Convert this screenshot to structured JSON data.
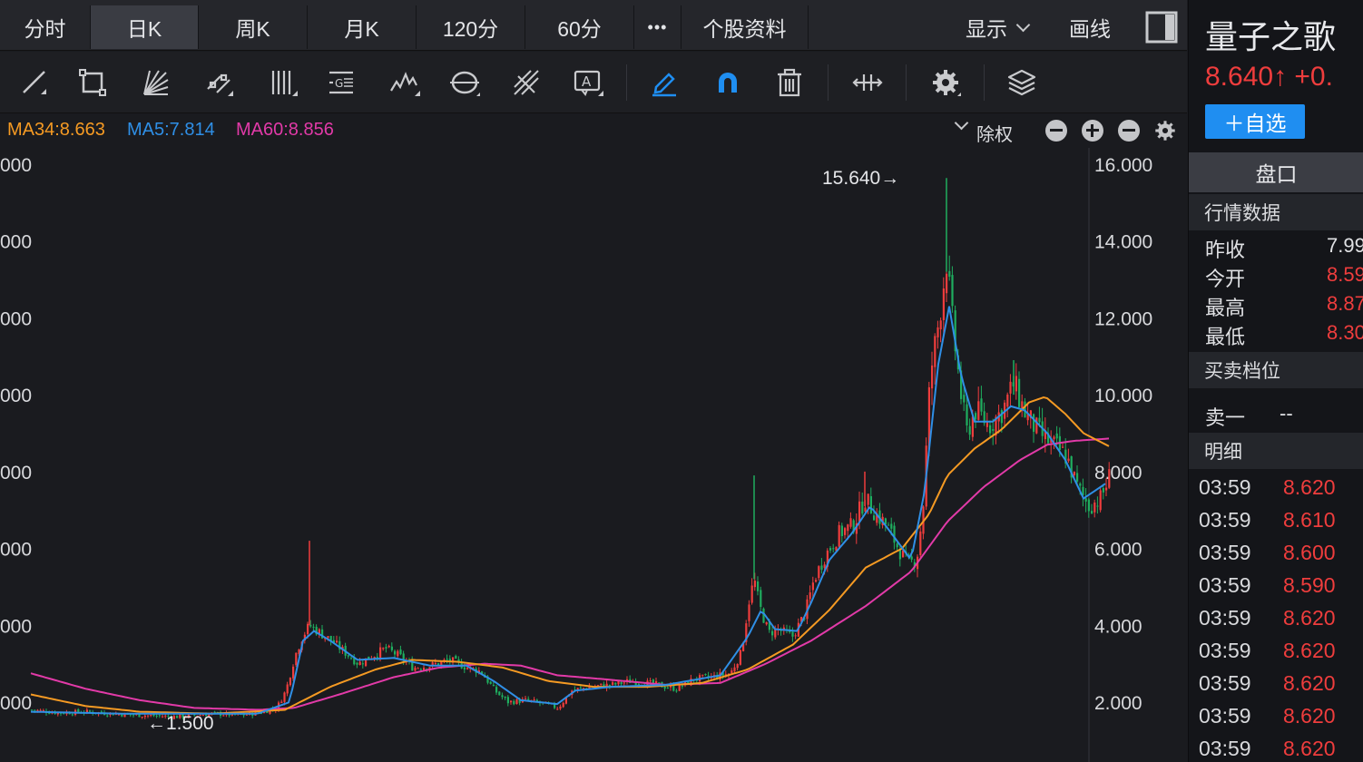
{
  "tabs": [
    {
      "label": "分时",
      "active": false
    },
    {
      "label": "日K",
      "active": true
    },
    {
      "label": "周K",
      "active": false
    },
    {
      "label": "月K",
      "active": false
    },
    {
      "label": "120分",
      "active": false
    },
    {
      "label": "60分",
      "active": false
    },
    {
      "label": "•••",
      "active": false
    },
    {
      "label": "个股资料",
      "active": false
    }
  ],
  "top_right": {
    "display_label": "显示",
    "draw_label": "画线"
  },
  "toolbar": {
    "icons": [
      "line-tool-icon",
      "rectangle-tool-icon",
      "fan-tool-icon",
      "channel-tool-icon",
      "vertical-lines-icon",
      "fibonacci-icon",
      "wave-tool-icon",
      "cycle-tool-icon",
      "pitchfork-icon",
      "text-annotation-icon",
      "pen-icon",
      "magnet-icon",
      "trash-icon",
      "drag-handle-icon",
      "settings-icon",
      "layers-icon"
    ],
    "colors": {
      "normal": "#c9cacd",
      "active": "#1f8ef1"
    }
  },
  "legend": {
    "ma34": "MA34:8.663",
    "ma5": "MA5:7.814",
    "ma60": "MA60:8.856",
    "adjust_label": "除权",
    "colors": {
      "ma34": "#f59a23",
      "ma5": "#2f8fe6",
      "ma60": "#e23aa8"
    }
  },
  "chart_data": {
    "type": "candlestick",
    "y_axis": {
      "ticks": [
        "16.000",
        "14.000",
        "12.000",
        "10.000",
        "8.000",
        "6.000",
        "4.000",
        "2.000"
      ],
      "ylim": [
        1.0,
        16.2
      ]
    },
    "left_axis_visible": [
      "000",
      "000",
      "000",
      "000",
      "000",
      "000",
      "000",
      "000"
    ],
    "annotations": {
      "high": "15.640→",
      "low": "←1.500"
    },
    "colors": {
      "up": "#ef3d3d",
      "down": "#1fae5f",
      "grid": "#2e3036",
      "axis_text": "#d8d9dc"
    },
    "price_path": [
      [
        0,
        1.8
      ],
      [
        30,
        1.72
      ],
      [
        60,
        1.75
      ],
      [
        100,
        1.68
      ],
      [
        130,
        1.65
      ],
      [
        160,
        1.62
      ],
      [
        200,
        1.7
      ],
      [
        230,
        1.66
      ],
      [
        250,
        1.72
      ],
      [
        270,
        1.85
      ],
      [
        280,
        2.3
      ],
      [
        290,
        3.2
      ],
      [
        298,
        3.7
      ],
      [
        306,
        4.0
      ],
      [
        318,
        3.8
      ],
      [
        330,
        3.6
      ],
      [
        345,
        3.3
      ],
      [
        360,
        3.0
      ],
      [
        375,
        3.2
      ],
      [
        390,
        3.4
      ],
      [
        405,
        3.2
      ],
      [
        420,
        2.9
      ],
      [
        440,
        2.95
      ],
      [
        460,
        3.1
      ],
      [
        480,
        2.9
      ],
      [
        495,
        2.8
      ],
      [
        510,
        2.3
      ],
      [
        525,
        2.0
      ],
      [
        545,
        2.05
      ],
      [
        565,
        1.95
      ],
      [
        580,
        1.85
      ],
      [
        595,
        2.3
      ],
      [
        615,
        2.4
      ],
      [
        640,
        2.45
      ],
      [
        660,
        2.55
      ],
      [
        690,
        2.45
      ],
      [
        710,
        2.35
      ],
      [
        730,
        2.6
      ],
      [
        750,
        2.65
      ],
      [
        770,
        2.75
      ],
      [
        782,
        3.3
      ],
      [
        790,
        4.6
      ],
      [
        796,
        5.2
      ],
      [
        802,
        4.5
      ],
      [
        812,
        3.8
      ],
      [
        822,
        3.9
      ],
      [
        838,
        3.7
      ],
      [
        852,
        4.3
      ],
      [
        862,
        5.2
      ],
      [
        874,
        5.8
      ],
      [
        890,
        6.4
      ],
      [
        905,
        6.6
      ],
      [
        918,
        7.3
      ],
      [
        930,
        6.9
      ],
      [
        942,
        6.6
      ],
      [
        955,
        6.0
      ],
      [
        965,
        5.6
      ],
      [
        975,
        5.7
      ],
      [
        982,
        7.0
      ],
      [
        990,
        10.5
      ],
      [
        1000,
        12.0
      ],
      [
        1008,
        13.5
      ],
      [
        1016,
        11.5
      ],
      [
        1024,
        10.0
      ],
      [
        1030,
        9.0
      ],
      [
        1040,
        9.6
      ],
      [
        1055,
        9.2
      ],
      [
        1070,
        9.6
      ],
      [
        1082,
        10.3
      ],
      [
        1095,
        9.5
      ],
      [
        1110,
        9.0
      ],
      [
        1125,
        8.7
      ],
      [
        1140,
        8.4
      ],
      [
        1152,
        7.6
      ],
      [
        1165,
        7.1
      ],
      [
        1178,
        7.3
      ],
      [
        1188,
        7.9
      ]
    ],
    "ma5_path": [
      [
        0,
        1.75
      ],
      [
        100,
        1.7
      ],
      [
        250,
        1.7
      ],
      [
        285,
        2.0
      ],
      [
        300,
        3.6
      ],
      [
        312,
        3.85
      ],
      [
        330,
        3.6
      ],
      [
        360,
        3.1
      ],
      [
        400,
        3.15
      ],
      [
        440,
        2.95
      ],
      [
        480,
        2.95
      ],
      [
        510,
        2.55
      ],
      [
        540,
        2.05
      ],
      [
        580,
        1.95
      ],
      [
        600,
        2.3
      ],
      [
        640,
        2.4
      ],
      [
        700,
        2.45
      ],
      [
        760,
        2.7
      ],
      [
        790,
        3.7
      ],
      [
        805,
        4.4
      ],
      [
        820,
        3.9
      ],
      [
        845,
        3.85
      ],
      [
        860,
        4.6
      ],
      [
        880,
        5.7
      ],
      [
        905,
        6.4
      ],
      [
        925,
        7.1
      ],
      [
        945,
        6.5
      ],
      [
        970,
        5.7
      ],
      [
        985,
        7.5
      ],
      [
        1000,
        10.8
      ],
      [
        1012,
        12.3
      ],
      [
        1025,
        10.5
      ],
      [
        1040,
        9.3
      ],
      [
        1060,
        9.3
      ],
      [
        1080,
        9.7
      ],
      [
        1095,
        9.6
      ],
      [
        1120,
        9.0
      ],
      [
        1140,
        8.3
      ],
      [
        1160,
        7.3
      ],
      [
        1185,
        7.7
      ]
    ],
    "ma34_path": [
      [
        0,
        2.2
      ],
      [
        60,
        1.9
      ],
      [
        120,
        1.75
      ],
      [
        200,
        1.7
      ],
      [
        280,
        1.8
      ],
      [
        330,
        2.4
      ],
      [
        380,
        2.85
      ],
      [
        420,
        3.1
      ],
      [
        470,
        3.05
      ],
      [
        520,
        2.9
      ],
      [
        570,
        2.55
      ],
      [
        620,
        2.4
      ],
      [
        680,
        2.4
      ],
      [
        740,
        2.5
      ],
      [
        790,
        2.85
      ],
      [
        840,
        3.5
      ],
      [
        880,
        4.4
      ],
      [
        920,
        5.5
      ],
      [
        960,
        6.0
      ],
      [
        990,
        6.9
      ],
      [
        1010,
        7.9
      ],
      [
        1040,
        8.6
      ],
      [
        1070,
        9.1
      ],
      [
        1100,
        9.8
      ],
      [
        1118,
        9.95
      ],
      [
        1140,
        9.5
      ],
      [
        1160,
        9.0
      ],
      [
        1188,
        8.66
      ]
    ],
    "ma60_path": [
      [
        0,
        2.75
      ],
      [
        60,
        2.35
      ],
      [
        120,
        2.05
      ],
      [
        180,
        1.85
      ],
      [
        250,
        1.8
      ],
      [
        290,
        1.85
      ],
      [
        340,
        2.2
      ],
      [
        400,
        2.65
      ],
      [
        450,
        2.9
      ],
      [
        500,
        3.0
      ],
      [
        540,
        2.95
      ],
      [
        580,
        2.7
      ],
      [
        630,
        2.6
      ],
      [
        700,
        2.45
      ],
      [
        760,
        2.5
      ],
      [
        810,
        3.0
      ],
      [
        860,
        3.6
      ],
      [
        920,
        4.5
      ],
      [
        970,
        5.4
      ],
      [
        1010,
        6.7
      ],
      [
        1050,
        7.6
      ],
      [
        1090,
        8.3
      ],
      [
        1120,
        8.7
      ],
      [
        1150,
        8.8
      ],
      [
        1188,
        8.86
      ]
    ]
  },
  "sidebar": {
    "stock_name": "量子之歌",
    "price": "8.640↑ +0.",
    "add_button": "＋自选",
    "pankou_tab": "盘口",
    "quote_header": "行情数据",
    "quotes": [
      {
        "label": "昨收",
        "value": "7.99",
        "color": "#e0e1e4"
      },
      {
        "label": "今开",
        "value": "8.59",
        "color": "#ef3d3d"
      },
      {
        "label": "最高",
        "value": "8.87",
        "color": "#ef3d3d"
      },
      {
        "label": "最低",
        "value": "8.30",
        "color": "#ef3d3d"
      }
    ],
    "order_header": "买卖档位",
    "order_row": {
      "label": "卖一",
      "value": "--"
    },
    "detail_header": "明细",
    "details": [
      {
        "time": "03:59",
        "price": "8.620"
      },
      {
        "time": "03:59",
        "price": "8.610"
      },
      {
        "time": "03:59",
        "price": "8.600"
      },
      {
        "time": "03:59",
        "price": "8.590"
      },
      {
        "time": "03:59",
        "price": "8.620"
      },
      {
        "time": "03:59",
        "price": "8.620"
      },
      {
        "time": "03:59",
        "price": "8.620"
      },
      {
        "time": "03:59",
        "price": "8.620"
      },
      {
        "time": "03:59",
        "price": "8.620"
      }
    ]
  }
}
